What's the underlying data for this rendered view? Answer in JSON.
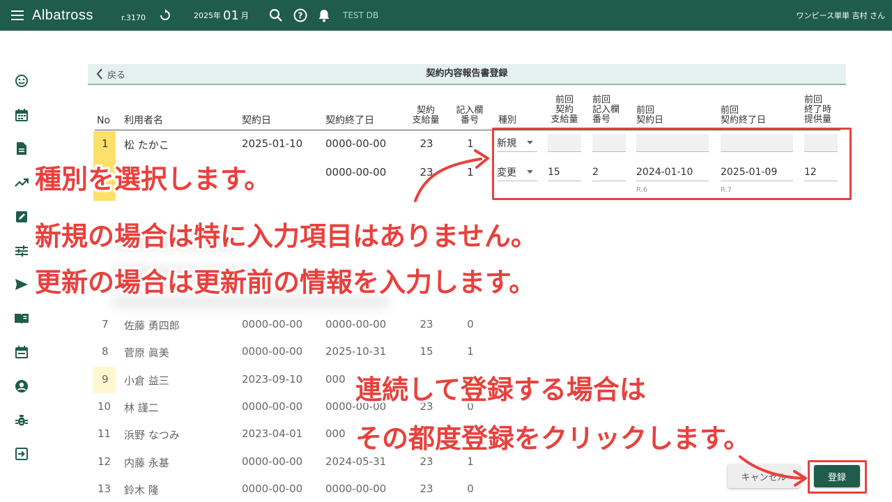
{
  "topbar": {
    "app_name": "Albatross",
    "version": "r.3170",
    "date_prefix": "2025年",
    "date_month": "01",
    "date_suffix": "月",
    "db_name": "TEST DB",
    "user": "ワンピース単単 吉村 さん"
  },
  "sidebar_icons": [
    "smile-icon",
    "calendar-icon",
    "document-icon",
    "trending-icon",
    "edit-icon",
    "sliders-icon",
    "send-icon",
    "book-icon",
    "event-icon",
    "account-icon",
    "bug-icon",
    "logout-icon"
  ],
  "panel": {
    "back_label": "戻る",
    "title": "契約内容報告書登録"
  },
  "headers": {
    "no": "No",
    "user": "利用者名",
    "contract_date": "契約日",
    "contract_end": "契約終了日",
    "supply_1": "契約",
    "supply_2": "支給量",
    "entry_1": "記入欄",
    "entry_2": "番号",
    "kind": "種別",
    "prev_supply_1": "前回",
    "prev_supply_2": "契約",
    "prev_supply_3": "支給量",
    "prev_entry_1": "前回",
    "prev_entry_2": "記入欄",
    "prev_entry_3": "番号",
    "prev_date_1": "前回",
    "prev_date_2": "契約日",
    "prev_end_1": "前回",
    "prev_end_2": "契約終了日",
    "prev_prov_1": "前回",
    "prev_prov_2": "終了時",
    "prev_prov_3": "提供量"
  },
  "rows": [
    {
      "no": "1",
      "name": "松 たかこ",
      "date": "2025-01-10",
      "end": "0000-00-00",
      "supply": "23",
      "entry": "1"
    },
    {
      "end": "0000-00-00",
      "supply": "23",
      "entry": "1"
    },
    {
      "no": "7",
      "name": "佐藤 勇四郎",
      "date": "0000-00-00",
      "end": "0000-00-00",
      "supply": "23",
      "entry": "0"
    },
    {
      "no": "8",
      "name": "菅原 眞美",
      "date": "0000-00-00",
      "end": "2025-10-31",
      "supply": "15",
      "entry": "1"
    },
    {
      "no": "9",
      "name": "小倉 益三",
      "date": "2023-09-10",
      "end": "000"
    },
    {
      "no": "10",
      "name": "林 謹二",
      "date": "0000-00-00",
      "end": "0000-00-00",
      "supply": "23",
      "entry": "0"
    },
    {
      "no": "11",
      "name": "浜野 なつみ",
      "date": "2023-04-01",
      "end": "000"
    },
    {
      "no": "12",
      "name": "内藤 永基",
      "date": "0000-00-00",
      "end": "2024-05-31",
      "supply": "23",
      "entry": "1"
    },
    {
      "no": "13",
      "name": "鈴木 隆",
      "date": "0000-00-00",
      "end": "0000-00-00",
      "supply": "23",
      "entry": "0"
    }
  ],
  "form_row1": {
    "kind": "新規"
  },
  "form_row2": {
    "kind": "変更",
    "prev_supply": "15",
    "prev_entry": "2",
    "prev_date": "2024-01-10",
    "prev_date_era": "R.6",
    "prev_end": "2025-01-09",
    "prev_end_era": "R.7",
    "prev_prov": "12"
  },
  "buttons": {
    "cancel": "キャンセル",
    "save": "登録"
  },
  "annotations": {
    "line1": "種別を選択します。",
    "line2": "新規の場合は特に入力項目はありません。",
    "line3": "更新の場合は更新前の情報を入力します。",
    "line4": "連続して登録する場合は",
    "line5": "その都度登録をクリックします。"
  },
  "colors": {
    "topbar": "#1f5c4b",
    "accent": "#e8413d",
    "highlight": "#fde06a"
  }
}
